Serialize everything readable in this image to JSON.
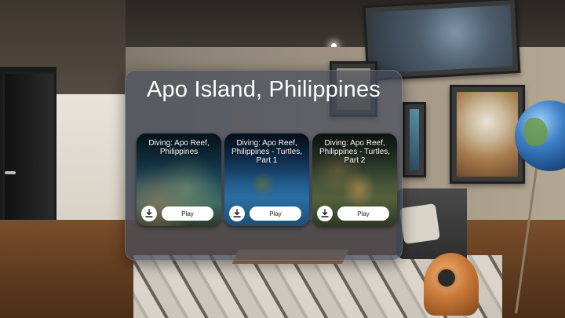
{
  "panel": {
    "title": "Apo Island, Philippines"
  },
  "videos": [
    {
      "title": "Diving: Apo Reef, Philippines",
      "play_label": "Play",
      "download_icon": "download-icon"
    },
    {
      "title": "Diving: Apo Reef, Philippines - Turtles, Part 1",
      "play_label": "Play",
      "download_icon": "download-icon"
    },
    {
      "title": "Diving: Apo Reef, Philippines - Turtles, Part 2",
      "play_label": "Play",
      "download_icon": "download-icon"
    }
  ],
  "colors": {
    "panel_bg": "#464e5c",
    "button_bg": "#ffffff",
    "text": "#ffffff"
  }
}
